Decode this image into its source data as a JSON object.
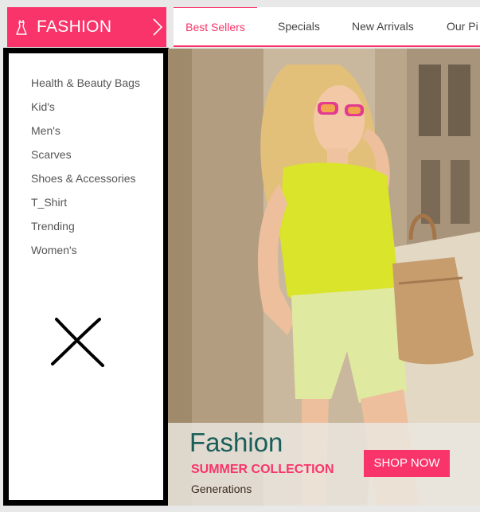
{
  "header": {
    "category_title": "FASHION",
    "accent_color": "#f8346a",
    "dress_icon": "dress-icon",
    "chevron_icon": "chevron-right-icon"
  },
  "nav": {
    "tabs": [
      {
        "label": "Best Sellers",
        "active": true
      },
      {
        "label": "Specials",
        "active": false
      },
      {
        "label": "New Arrivals",
        "active": false
      },
      {
        "label": "Our Pi",
        "active": false
      }
    ]
  },
  "sidebar": {
    "items": [
      {
        "label": "Health & Beauty Bags"
      },
      {
        "label": "Kid's"
      },
      {
        "label": "Men's"
      },
      {
        "label": "Scarves"
      },
      {
        "label": "Shoes & Accessories"
      },
      {
        "label": "T_Shirt"
      },
      {
        "label": "Trending"
      },
      {
        "label": "Women's"
      }
    ],
    "cross_mark": "cross-mark-annotation",
    "border_color": "#000000"
  },
  "banner": {
    "title": "Fashion",
    "subtitle": "SUMMER COLLECTION",
    "tagline": "Generations",
    "cta_label": "SHOP NOW",
    "title_color": "#1a5e5a"
  }
}
